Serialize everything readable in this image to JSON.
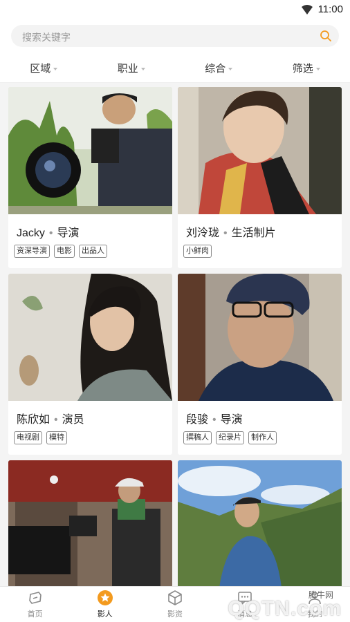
{
  "status": {
    "time": "11:00"
  },
  "search": {
    "placeholder": "搜索关键字"
  },
  "filters": [
    {
      "label": "区域"
    },
    {
      "label": "职业"
    },
    {
      "label": "综合"
    },
    {
      "label": "筛选"
    }
  ],
  "cards": [
    {
      "name": "Jacky",
      "role": "导演",
      "tags": [
        "资深导演",
        "电影",
        "出品人"
      ]
    },
    {
      "name": "刘泠珑",
      "role": "生活制片",
      "tags": [
        "小鲜肉"
      ]
    },
    {
      "name": "陈欣如",
      "role": "演员",
      "tags": [
        "电视剧",
        "模特"
      ]
    },
    {
      "name": "段骏",
      "role": "导演",
      "tags": [
        "撰稿人",
        "纪录片",
        "制作人"
      ]
    }
  ],
  "tabbar": [
    {
      "label": "首页",
      "icon": "home-icon"
    },
    {
      "label": "影人",
      "icon": "star-badge-icon",
      "active": true
    },
    {
      "label": "影资",
      "icon": "cube-icon"
    },
    {
      "label": "消息",
      "icon": "message-icon"
    },
    {
      "label": "我的",
      "icon": "profile-icon"
    }
  ],
  "watermark": {
    "small": "腾牛网",
    "big": "QQTN.com"
  },
  "colors": {
    "accent": "#f39a1e",
    "background": "#f4f4f4",
    "card": "#ffffff"
  }
}
